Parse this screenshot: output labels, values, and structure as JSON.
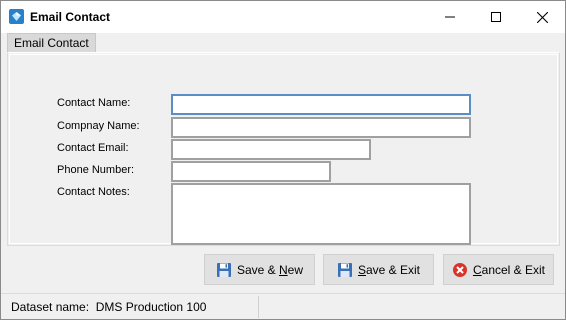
{
  "window": {
    "title": "Email Contact",
    "icon": "app-diamond-icon"
  },
  "tab": {
    "label": "Email Contact"
  },
  "form": {
    "contact_name_label": "Contact Name:",
    "contact_name_value": "",
    "company_name_label": "Compnay Name:",
    "company_name_value": "",
    "contact_email_label": "Contact Email:",
    "contact_email_value": "",
    "phone_number_label": "Phone Number:",
    "phone_number_value": "",
    "contact_notes_label": "Contact Notes:",
    "contact_notes_value": ""
  },
  "buttons": {
    "save_new_prefix": "Save & ",
    "save_new_mnemonic": "N",
    "save_new_suffix": "ew",
    "save_exit_mnemonic": "S",
    "save_exit_suffix": "ave & Exit",
    "cancel_exit_mnemonic": "C",
    "cancel_exit_suffix": "ancel & Exit"
  },
  "status": {
    "dataset_label": "Dataset name:",
    "dataset_value": "DMS Production 100"
  },
  "colors": {
    "focus_border": "#5b8ec4",
    "save_icon": "#3b6fb6",
    "cancel_icon": "#d9342b"
  }
}
